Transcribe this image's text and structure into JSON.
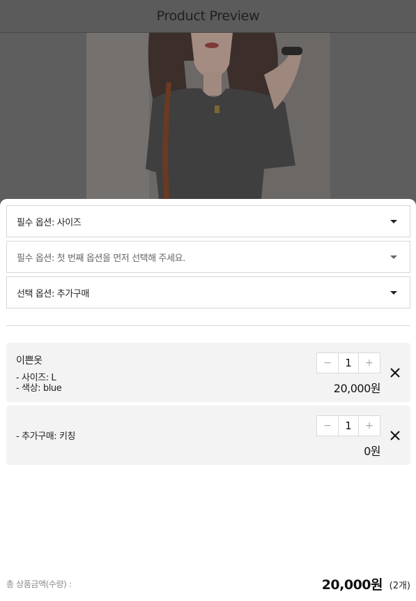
{
  "header": {
    "title": "Product Preview"
  },
  "product_image": {
    "icon": "product-photo-knit-top"
  },
  "options": [
    {
      "label": "필수 옵션: 사이즈",
      "muted": false
    },
    {
      "label": "필수 옵션: 첫 번째 옵션을 먼저 선택해 주세요.",
      "muted": true
    },
    {
      "label": "선택 옵션: 추가구매",
      "muted": false
    }
  ],
  "cart_items": [
    {
      "name": "이쁜옷",
      "options": [
        "- 사이즈: L",
        "- 색상: blue"
      ],
      "quantity": "1",
      "price": "20,000원"
    },
    {
      "name": "",
      "options": [
        "- 추가구매: 키칭"
      ],
      "quantity": "1",
      "price": "0원"
    }
  ],
  "stepper": {
    "minus": "−",
    "plus": "+"
  },
  "total": {
    "label": "총 상품금액(수량) :",
    "amount": "20,000원",
    "count": "(2개)"
  }
}
